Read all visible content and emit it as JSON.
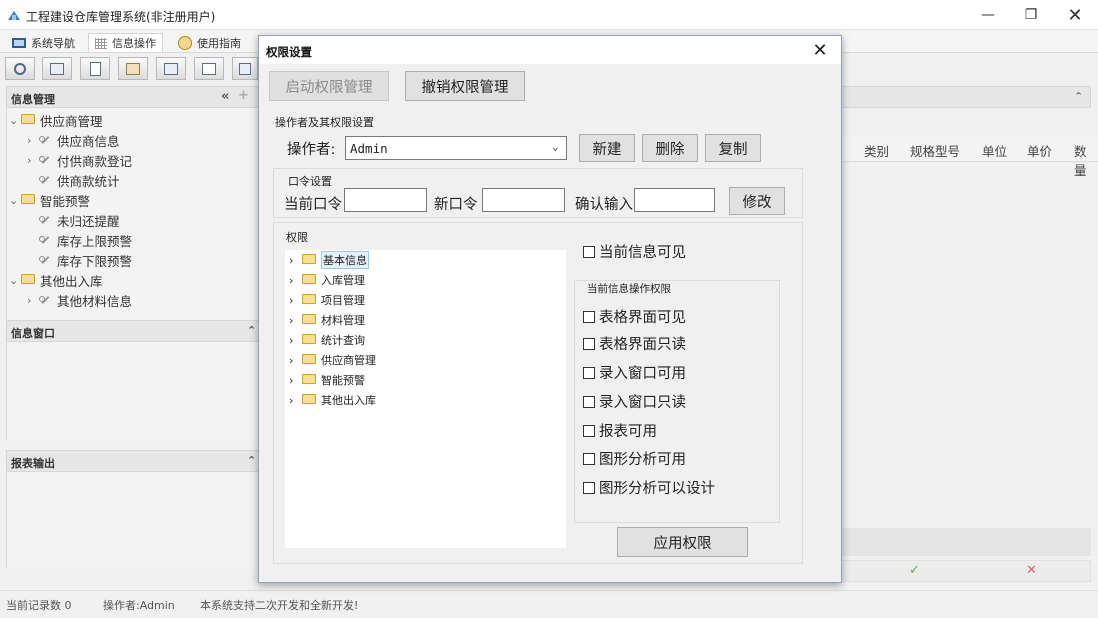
{
  "window": {
    "title": "工程建设仓库管理系统(非注册用户)"
  },
  "menu_tabs": [
    {
      "label": "系统导航"
    },
    {
      "label": "信息操作"
    },
    {
      "label": "使用指南"
    }
  ],
  "left_panel": {
    "info_header": "信息管理",
    "tree": [
      {
        "label": "供应商管理"
      },
      {
        "label": "供应商信息"
      },
      {
        "label": "付供商款登记"
      },
      {
        "label": "供商款统计"
      },
      {
        "label": "智能预警"
      },
      {
        "label": "未归还提醒"
      },
      {
        "label": "库存上限预警"
      },
      {
        "label": "库存下限预警"
      },
      {
        "label": "其他出入库"
      },
      {
        "label": "其他材料信息"
      }
    ],
    "info_window_header": "信息窗口",
    "report_header": "报表输出"
  },
  "grid": {
    "columns": [
      "类别",
      "规格型号",
      "单位",
      "单价",
      "数量"
    ]
  },
  "status_bar": {
    "record_count": "当前记录数 0",
    "operator": "操作者:Admin",
    "note": "本系统支持二次开发和全新开发!"
  },
  "dialog": {
    "title": "权限设置",
    "enable_btn": "启动权限管理",
    "revoke_btn": "撤销权限管理",
    "operator_section": "操作者及其权限设置",
    "operator_label": "操作者:",
    "operator_value": "Admin",
    "new_btn": "新建",
    "delete_btn": "删除",
    "copy_btn": "复制",
    "password_section": "口令设置",
    "current_pwd_label": "当前口令",
    "new_pwd_label": "新口令",
    "confirm_label": "确认输入",
    "modify_btn": "修改",
    "perm_section": "权限",
    "perm_tree": [
      {
        "label": "基本信息"
      },
      {
        "label": "入库管理"
      },
      {
        "label": "项目管理"
      },
      {
        "label": "材料管理"
      },
      {
        "label": "统计查询"
      },
      {
        "label": "供应商管理"
      },
      {
        "label": "智能预警"
      },
      {
        "label": "其他出入库"
      }
    ],
    "visible_chk": "当前信息可见",
    "ops_section": "当前信息操作权限",
    "ops": [
      {
        "label": "表格界面可见"
      },
      {
        "label": "表格界面只读"
      },
      {
        "label": "录入窗口可用"
      },
      {
        "label": "录入窗口只读"
      },
      {
        "label": "报表可用"
      },
      {
        "label": "图形分析可用"
      },
      {
        "label": "图形分析可以设计"
      }
    ],
    "apply_btn": "应用权限"
  }
}
